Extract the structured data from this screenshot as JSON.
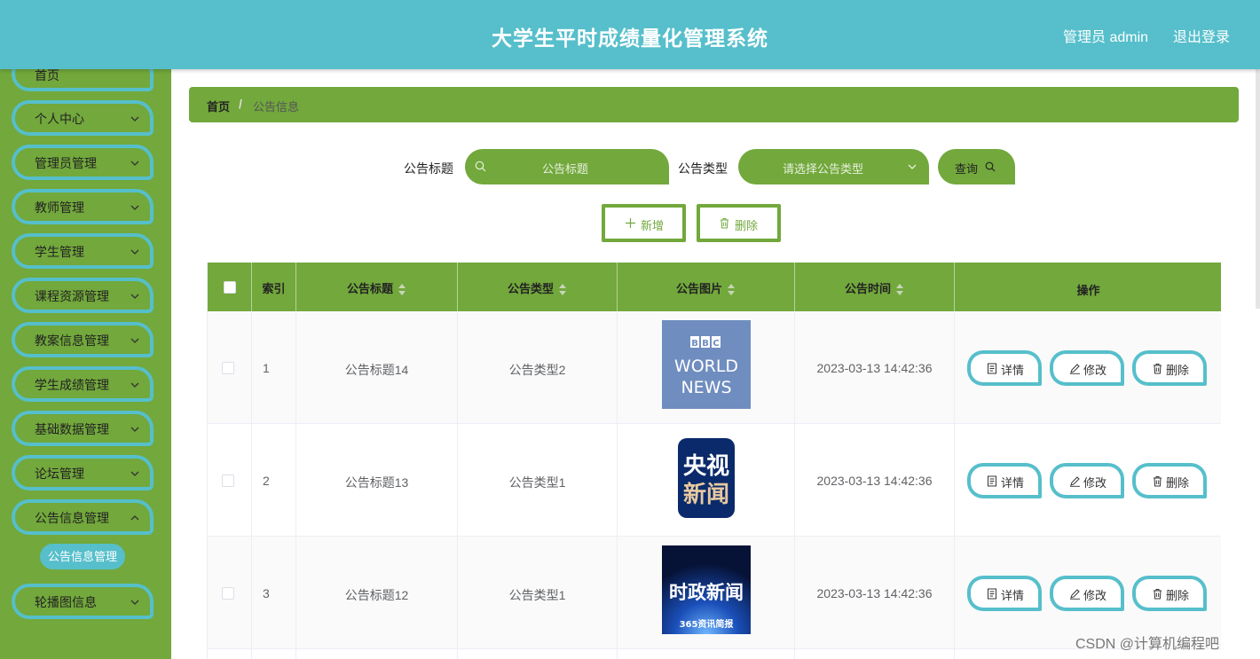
{
  "header": {
    "title": "大学生平时成绩量化管理系统",
    "user": "管理员 admin",
    "logout": "退出登录",
    "bg_color": "#56bfcb"
  },
  "sidebar": {
    "bg_color": "#72a83c",
    "items": [
      {
        "label": "首页"
      },
      {
        "label": "个人中心"
      },
      {
        "label": "管理员管理"
      },
      {
        "label": "教师管理"
      },
      {
        "label": "学生管理"
      },
      {
        "label": "课程资源管理"
      },
      {
        "label": "教案信息管理"
      },
      {
        "label": "学生成绩管理"
      },
      {
        "label": "基础数据管理"
      },
      {
        "label": "论坛管理"
      },
      {
        "label": "公告信息管理"
      },
      {
        "label": "轮播图信息"
      }
    ],
    "active_sub": "公告信息管理"
  },
  "breadcrumb": {
    "home": "首页",
    "sep": "/",
    "current": "公告信息"
  },
  "search": {
    "title_label": "公告标题",
    "title_placeholder": "公告标题",
    "type_label": "公告类型",
    "type_placeholder": "请选择公告类型",
    "query_label": "查询"
  },
  "actions": {
    "add_label": "新增",
    "delete_label": "删除"
  },
  "table": {
    "columns": {
      "index": "索引",
      "title": "公告标题",
      "type": "公告类型",
      "image": "公告图片",
      "time": "公告时间",
      "ops": "操作"
    },
    "rows": [
      {
        "index": "1",
        "title": "公告标题14",
        "type": "公告类型2",
        "time": "2023-03-13 14:42:36",
        "image": {
          "kind": "bbc",
          "lines": [
            "B",
            "B",
            "C",
            "WORLD",
            "NEWS"
          ]
        }
      },
      {
        "index": "2",
        "title": "公告标题13",
        "type": "公告类型1",
        "time": "2023-03-13 14:42:36",
        "image": {
          "kind": "cctv",
          "lines": [
            "央视",
            "新闻"
          ]
        }
      },
      {
        "index": "3",
        "title": "公告标题12",
        "type": "公告类型1",
        "time": "2023-03-13 14:42:36",
        "image": {
          "kind": "szxw",
          "lines": [
            "时政新闻",
            "365资讯简报"
          ]
        }
      }
    ],
    "op_labels": {
      "detail": "详情",
      "edit": "修改",
      "delete": "删除"
    }
  },
  "watermark": "CSDN @计算机编程吧"
}
